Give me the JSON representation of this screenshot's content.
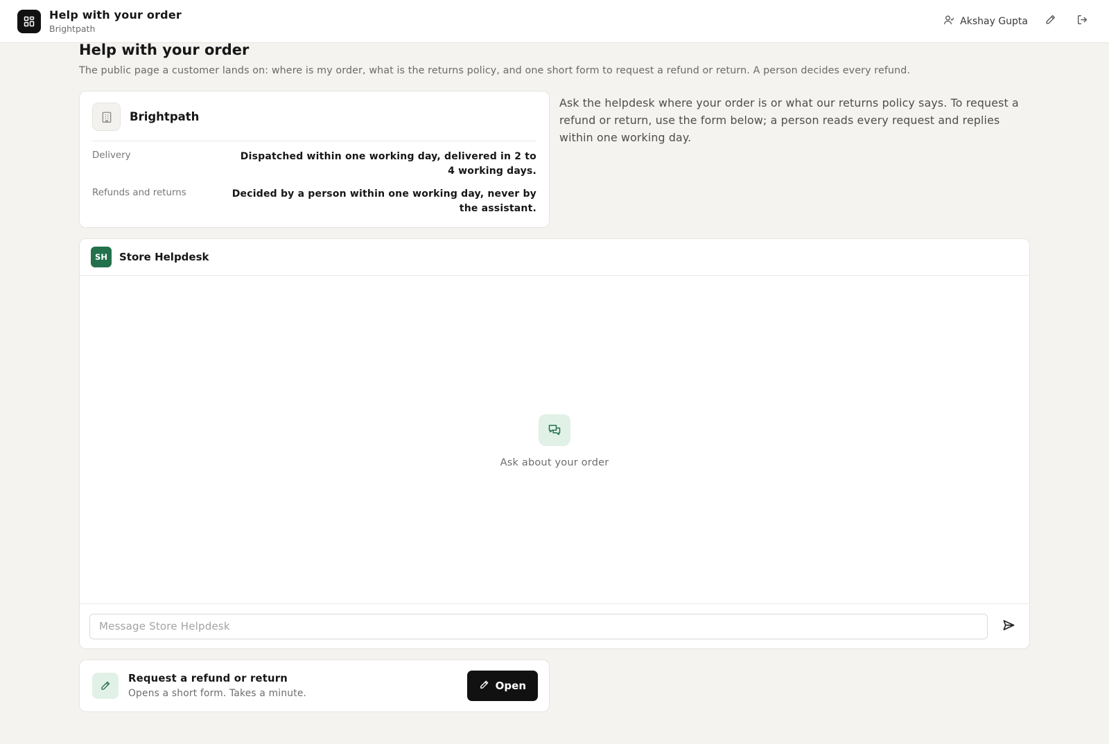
{
  "app": {
    "title": "Help with your order",
    "subtitle": "Brightpath",
    "icon": "dashboard-grid-icon"
  },
  "user": {
    "name": "Akshay Gupta",
    "icon": "user-icon"
  },
  "toolbar": {
    "edit_icon": "pencil-icon",
    "logout_icon": "logout-icon"
  },
  "page": {
    "title": "Help with your order",
    "description": "The public page a customer lands on: where is my order, what is the returns policy, and one short form to request a refund or return. A person decides every refund."
  },
  "store": {
    "name": "Brightpath",
    "icon": "building-icon",
    "info": [
      {
        "label": "Delivery",
        "value": "Dispatched within one working day, delivered in 2 to 4 working days."
      },
      {
        "label": "Refunds and returns",
        "value": "Decided by a person within one working day, never by the assistant."
      }
    ]
  },
  "side_note": "Ask the helpdesk where your order is or what our returns policy says. To request a refund or return, use the form below; a person reads every request and replies within one working day.",
  "chat": {
    "avatar_initials": "SH",
    "name": "Store Helpdesk",
    "empty_icon": "chat-bubbles-icon",
    "empty_text": "Ask about your order",
    "input_value": "",
    "input_placeholder": "Message Store Helpdesk",
    "send_icon": "send-icon"
  },
  "refund": {
    "icon": "pencil-icon",
    "title": "Request a refund or return",
    "subtitle": "Opens a short form. Takes a minute.",
    "button_label": "Open"
  },
  "colors": {
    "accent_green": "#23714c",
    "soft_green": "#e2f1e7",
    "background": "#f4f3f0",
    "primary_button": "#111111"
  }
}
